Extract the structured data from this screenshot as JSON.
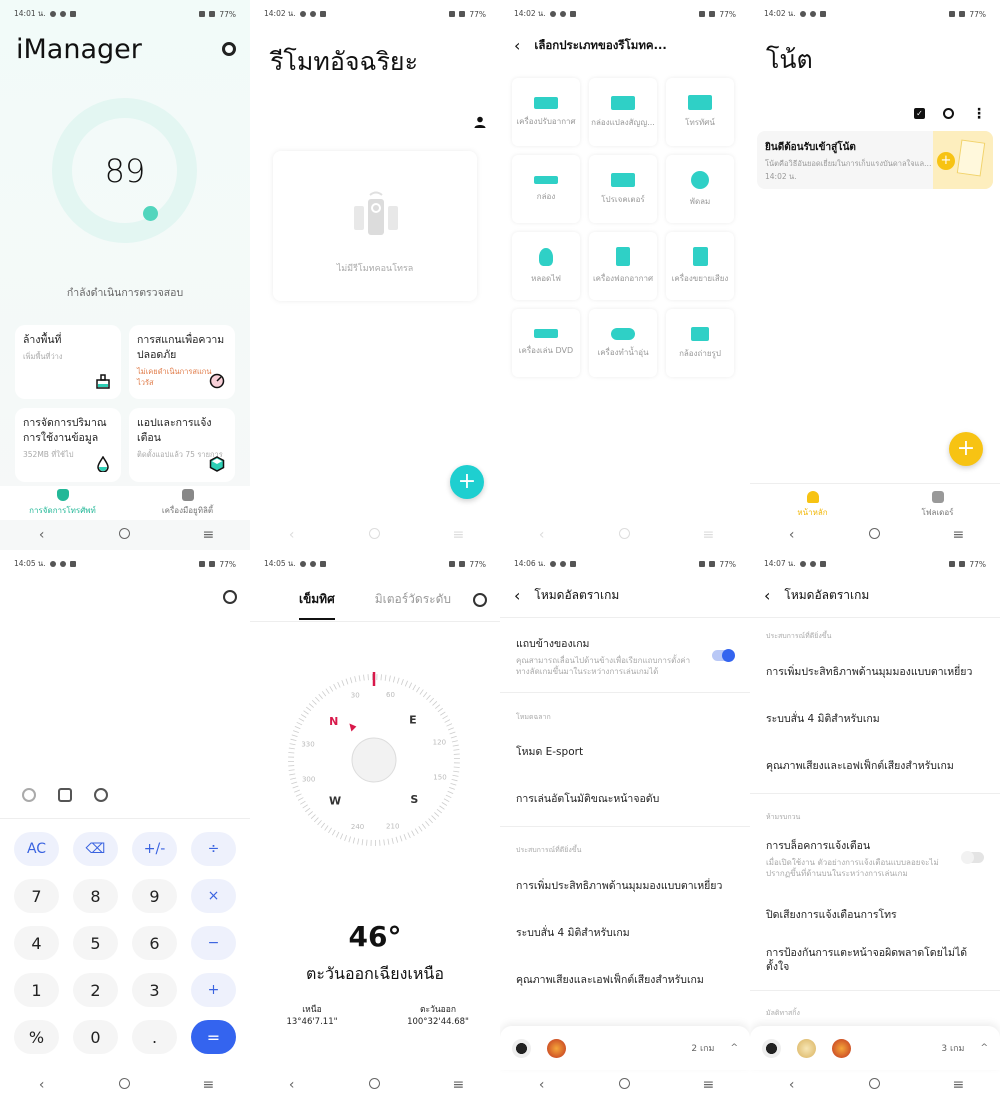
{
  "status_bar": {
    "battery": "77%"
  },
  "screens": {
    "imanager": {
      "time": "14:01 น.",
      "title": "iManager",
      "score": "89",
      "score_progress": 0.89,
      "status_text": "กำลังดำเนินการตรวจสอบ",
      "cards": [
        {
          "title": "ล้างพื้นที่",
          "sub": "เพิ่มพื้นที่ว่าง",
          "icon": "broom-icon"
        },
        {
          "title": "การสแกนเพื่อความปลอดภัย",
          "sub": "ไม่เคยดำเนินการสแกนไวรัส",
          "icon": "gauge-icon",
          "warn": true
        },
        {
          "title": "การจัดการปริมาณการใช้งานข้อมูล",
          "sub": "352MB ที่ใช้ไป",
          "icon": "drop-icon"
        },
        {
          "title": "แอปและการแจ้งเตือน",
          "sub": "ติดตั้งแอปแล้ว 75 รายการ",
          "icon": "hexagon-icon"
        }
      ],
      "tabs": [
        {
          "label": "การจัดการโทรศัพท์",
          "active": true
        },
        {
          "label": "เครื่องมือยูทิลิตี้",
          "active": false
        }
      ],
      "accent": "#23b898"
    },
    "remote": {
      "time": "14:02 น.",
      "title": "รีโมทอัจฉริยะ",
      "empty_text": "ไม่มีรีโมทคอนโทรล",
      "fab": "+",
      "accent": "#1ecfd0"
    },
    "remote_type": {
      "time": "14:02 น.",
      "title": "เลือกประเภทของรีโมทค...",
      "types": [
        "เครื่องปรับอากาศ",
        "กล่องแปลงสัญญ...",
        "โทรทัศน์",
        "กล่อง",
        "โปรเจคเตอร์",
        "พัดลม",
        "หลอดไฟ",
        "เครื่องฟอกอากาศ",
        "เครื่องขยายเสียง",
        "เครื่องเล่น DVD",
        "เครื่องทำน้ำอุ่น",
        "กล้องถ่ายรูป"
      ]
    },
    "notes": {
      "time": "14:02 น.",
      "title": "โน้ต",
      "note": {
        "title": "ยินดีต้อนรับเข้าสู่โน้ต",
        "body": "โน้ตคือวิธีอันยอดเยี่ยมในการเก็บแรงบันดาลใจและ...",
        "time": "14:02 น."
      },
      "fab": "+",
      "tabs": [
        {
          "label": "หน้าหลัก",
          "active": true
        },
        {
          "label": "โฟลเดอร์",
          "active": false
        }
      ],
      "accent": "#f7c313"
    },
    "calculator": {
      "time": "14:05 น.",
      "keys": [
        {
          "label": "AC",
          "type": "op"
        },
        {
          "label": "⌫",
          "type": "op"
        },
        {
          "label": "+/-",
          "type": "op"
        },
        {
          "label": "÷",
          "type": "op"
        },
        {
          "label": "7",
          "type": "num"
        },
        {
          "label": "8",
          "type": "num"
        },
        {
          "label": "9",
          "type": "num"
        },
        {
          "label": "×",
          "type": "op"
        },
        {
          "label": "4",
          "type": "num"
        },
        {
          "label": "5",
          "type": "num"
        },
        {
          "label": "6",
          "type": "num"
        },
        {
          "label": "−",
          "type": "op"
        },
        {
          "label": "1",
          "type": "num"
        },
        {
          "label": "2",
          "type": "num"
        },
        {
          "label": "3",
          "type": "num"
        },
        {
          "label": "+",
          "type": "op"
        },
        {
          "label": "%",
          "type": "num"
        },
        {
          "label": "0",
          "type": "num"
        },
        {
          "label": ".",
          "type": "num"
        },
        {
          "label": "=",
          "type": "eq"
        }
      ],
      "accent": "#3464ef"
    },
    "compass": {
      "time": "14:05 น.",
      "tabs": [
        {
          "label": "เข็มทิศ",
          "active": true
        },
        {
          "label": "มิเตอร์วัดระดับ",
          "active": false
        }
      ],
      "heading_deg": 46,
      "heading": "46°",
      "direction": "ตะวันออกเฉียงเหนือ",
      "cardinals": [
        "N",
        "E",
        "S",
        "W"
      ],
      "dial_numbers": [
        "30",
        "60",
        "120",
        "150",
        "210",
        "240",
        "300",
        "330"
      ],
      "lat_label": "เหนือ",
      "lat": "13°46'7.11\"",
      "lon_label": "ตะวันออก",
      "lon": "100°32'44.68\"",
      "accent": "#d8184a"
    },
    "game_mode_1": {
      "time": "14:06 น.",
      "title": "โหมดอัลตราเกม",
      "sidebar_title": "แถบข้างของเกม",
      "sidebar_sub": "คุณสามารถเลื่อนไปด้านข้างเพื่อเรียกแถบการตั้งค่าทางลัดเกมขึ้นมาในระหว่างการเล่นเกมได้",
      "sidebar_enabled": true,
      "section_smart": "โหมดฉลาก",
      "esport": "โหมด E-sport",
      "auto_play": "การเล่นอัตโนมัติขณะหน้าจอดับ",
      "section_exp": "ประสบการณ์ที่ดียิ่งขึ้น",
      "exp_items": [
        "การเพิ่มประสิทธิภาพด้านมุมมองแบบตาเหยี่ยว",
        "ระบบสั่น 4 มิติสำหรับเกม",
        "คุณภาพเสียงและเอฟเฟ็กต์เสียงสำหรับเกม"
      ],
      "game_count": "2 เกม"
    },
    "game_mode_2": {
      "time": "14:07 น.",
      "title": "โหมดอัลตราเกม",
      "section_exp": "ประสบการณ์ที่ดียิ่งขึ้น",
      "exp_items": [
        "การเพิ่มประสิทธิภาพด้านมุมมองแบบตาเหยี่ยว",
        "ระบบสั่น 4 มิติสำหรับเกม",
        "คุณภาพเสียงและเอฟเฟ็กต์เสียงสำหรับเกม"
      ],
      "section_dnd": "ห้ามรบกวน",
      "block_title": "การบล็อคการแจ้งเตือน",
      "block_sub": "เมื่อเปิดใช้งาน ตัวอย่างการแจ้งเตือนแบบลอยจะไม่ปรากฏขึ้นที่ด้านบนในระหว่างการเล่นเกม",
      "block_enabled": false,
      "mute_calls": "ปิดเสียงการแจ้งเตือนการโทร",
      "prevent_touch": "การป้องกันการแตะหน้าจอผิดพลาดโดยไม่ได้ตั้งใจ",
      "section_multi": "มัลติทาสกิ้ง",
      "game_count": "3 เกม"
    }
  }
}
